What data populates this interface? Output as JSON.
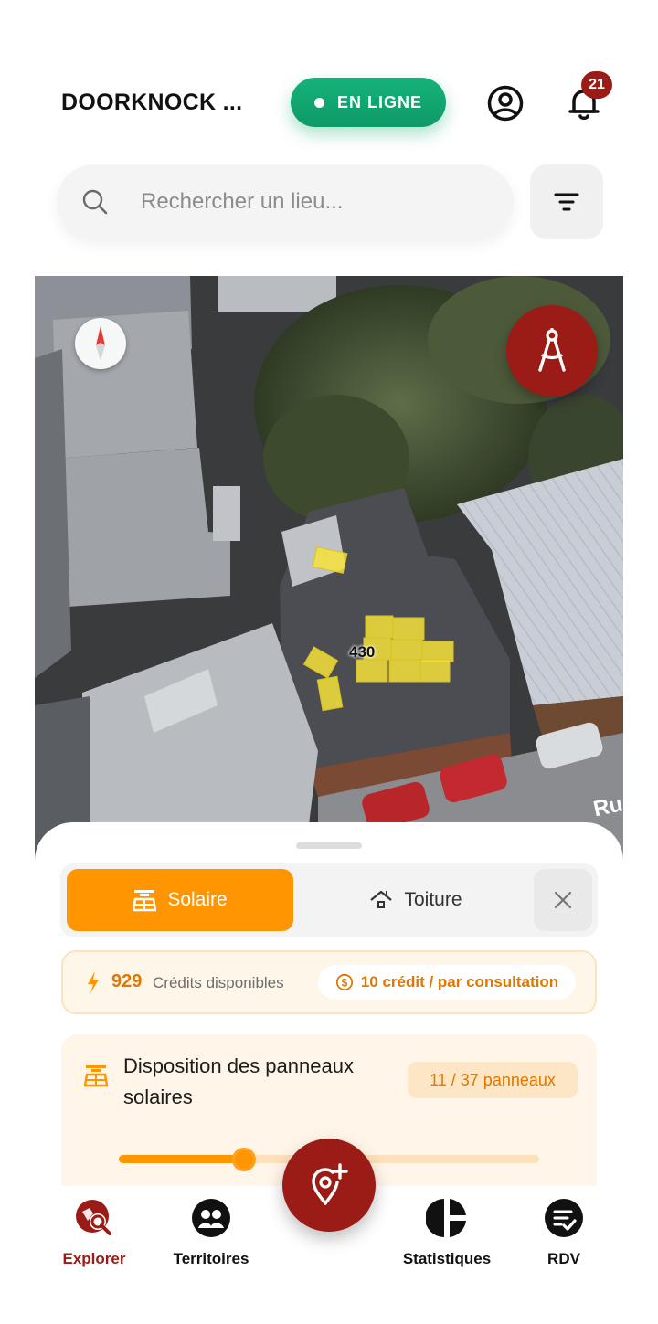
{
  "header": {
    "app_title": "DOORKNOCK ...",
    "status_label": "EN LIGNE",
    "notification_count": "21",
    "status_color": "#14a874",
    "brand_color": "#9b1b16"
  },
  "search": {
    "placeholder": "Rechercher un lieu...",
    "value": ""
  },
  "map": {
    "address_number": "430",
    "street_fragment": "Ru",
    "panel_color": "#f5e23a"
  },
  "tabs": {
    "solar_label": "Solaire",
    "roof_label": "Toiture",
    "active": "Solaire",
    "accent_color": "#ff9500"
  },
  "credits": {
    "available": "929",
    "available_label": "Crédits disponibles",
    "cost_label": "10 crédit / par consultation"
  },
  "panels": {
    "title": "Disposition des panneaux solaires",
    "count_label": "11 / 37 panneaux",
    "selected": 11,
    "total": 37
  },
  "nav": {
    "items": [
      {
        "label": "Explorer",
        "icon": "explore-search-icon",
        "active": true
      },
      {
        "label": "Territoires",
        "icon": "territories-icon",
        "active": false
      },
      {
        "label": "Statistiques",
        "icon": "pie-chart-icon",
        "active": false
      },
      {
        "label": "RDV",
        "icon": "appointment-check-icon",
        "active": false
      }
    ],
    "fab_icon": "add-location-icon"
  }
}
